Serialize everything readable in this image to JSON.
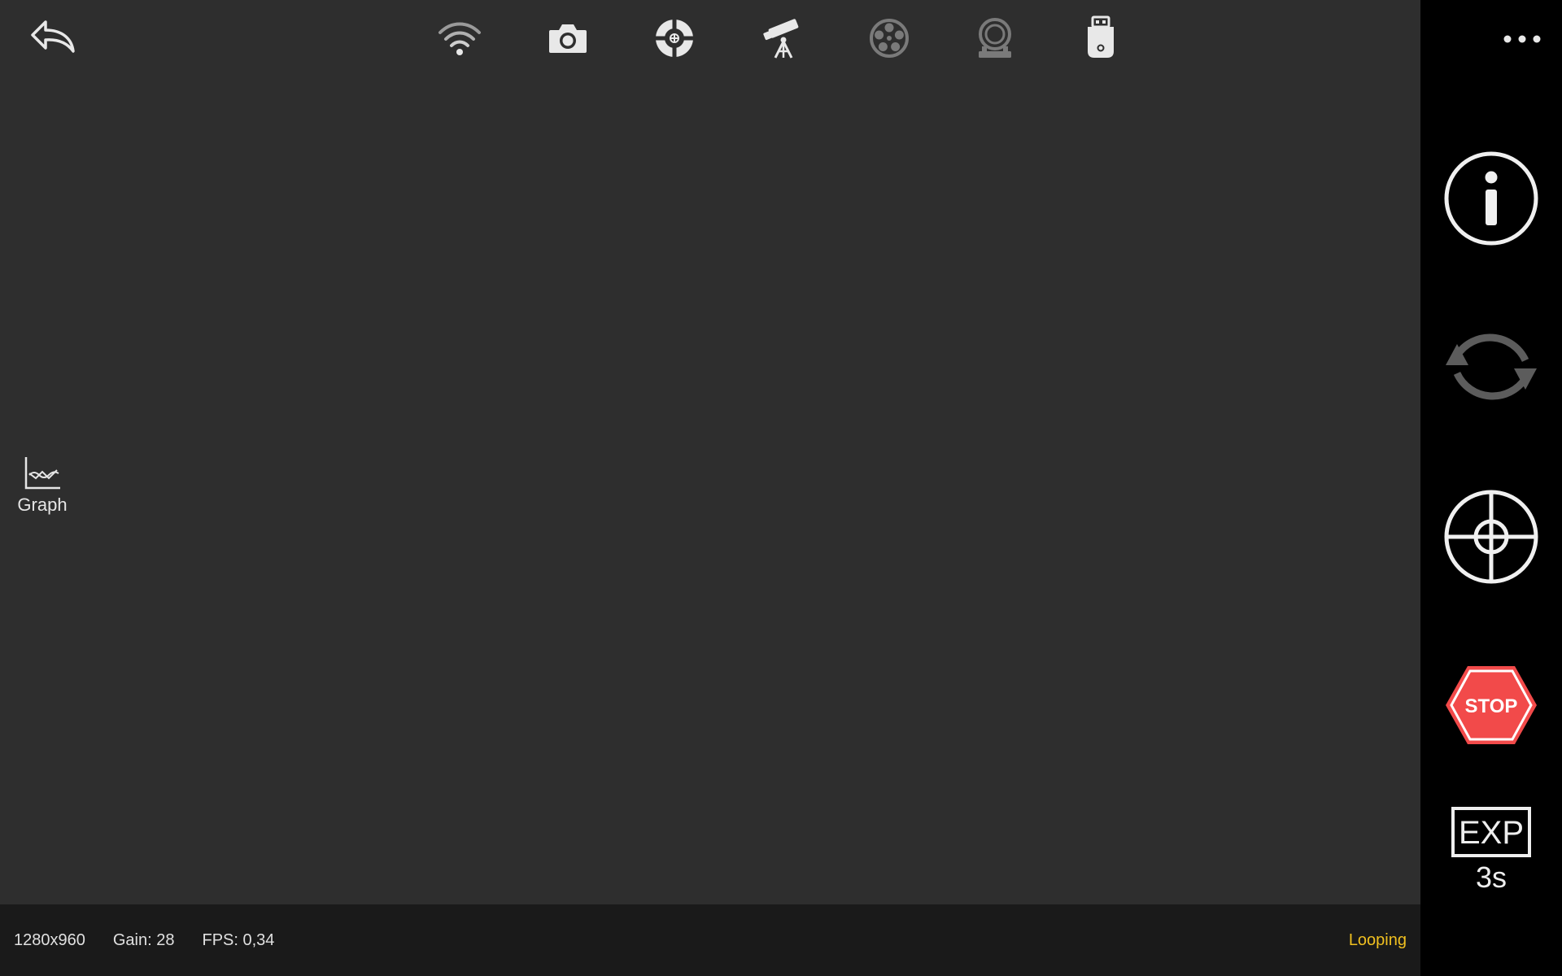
{
  "toolbar": {
    "icons": [
      "back-icon",
      "wifi-icon",
      "camera-icon",
      "guider-icon",
      "telescope-icon",
      "filter-wheel-icon",
      "focuser-icon",
      "usb-stick-icon"
    ]
  },
  "left": {
    "graph_label": "Graph"
  },
  "status": {
    "resolution": "1280x960",
    "gain": "Gain: 28",
    "fps": "FPS: 0,34",
    "mode": "Looping"
  },
  "right_panel": {
    "stop_label": "STOP",
    "exp_badge": "EXP",
    "exposure": "3s"
  },
  "colors": {
    "viewport_bg": "#2e2e2e",
    "status_bg": "#1a1a1a",
    "panel_bg": "#000000",
    "stop_red": "#f24a4a",
    "mode_yellow": "#f0c020"
  }
}
